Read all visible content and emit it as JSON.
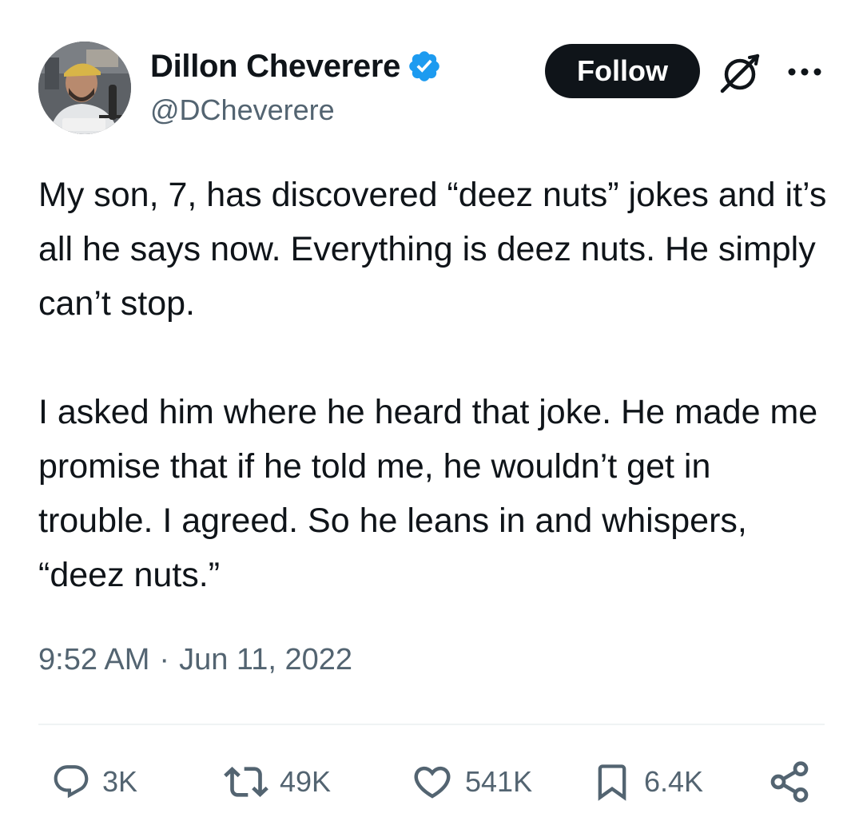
{
  "author": {
    "display_name": "Dillon Cheverere",
    "handle": "@DCheverere",
    "verified": true,
    "verified_color": "#1d9bf0"
  },
  "header": {
    "follow_label": "Follow",
    "grok_icon": "grok-icon",
    "more_icon": "more-icon"
  },
  "tweet": {
    "paragraphs": [
      "My son, 7, has discovered “deez nuts” jokes and it’s all he says now. Everything is deez nuts. He simply can’t stop.",
      "I asked him where he heard that joke. He made me promise that if he told me, he wouldn’t get in trouble. I agreed. So he leans in and whispers, “deez nuts.”"
    ],
    "time": "9:52 AM",
    "separator": "·",
    "date": "Jun 11, 2022"
  },
  "actions": {
    "replies": "3K",
    "reposts": "49K",
    "likes": "541K",
    "bookmarks": "6.4K"
  },
  "colors": {
    "text": "#0f1419",
    "secondary": "#536471",
    "divider": "#eff3f4"
  }
}
